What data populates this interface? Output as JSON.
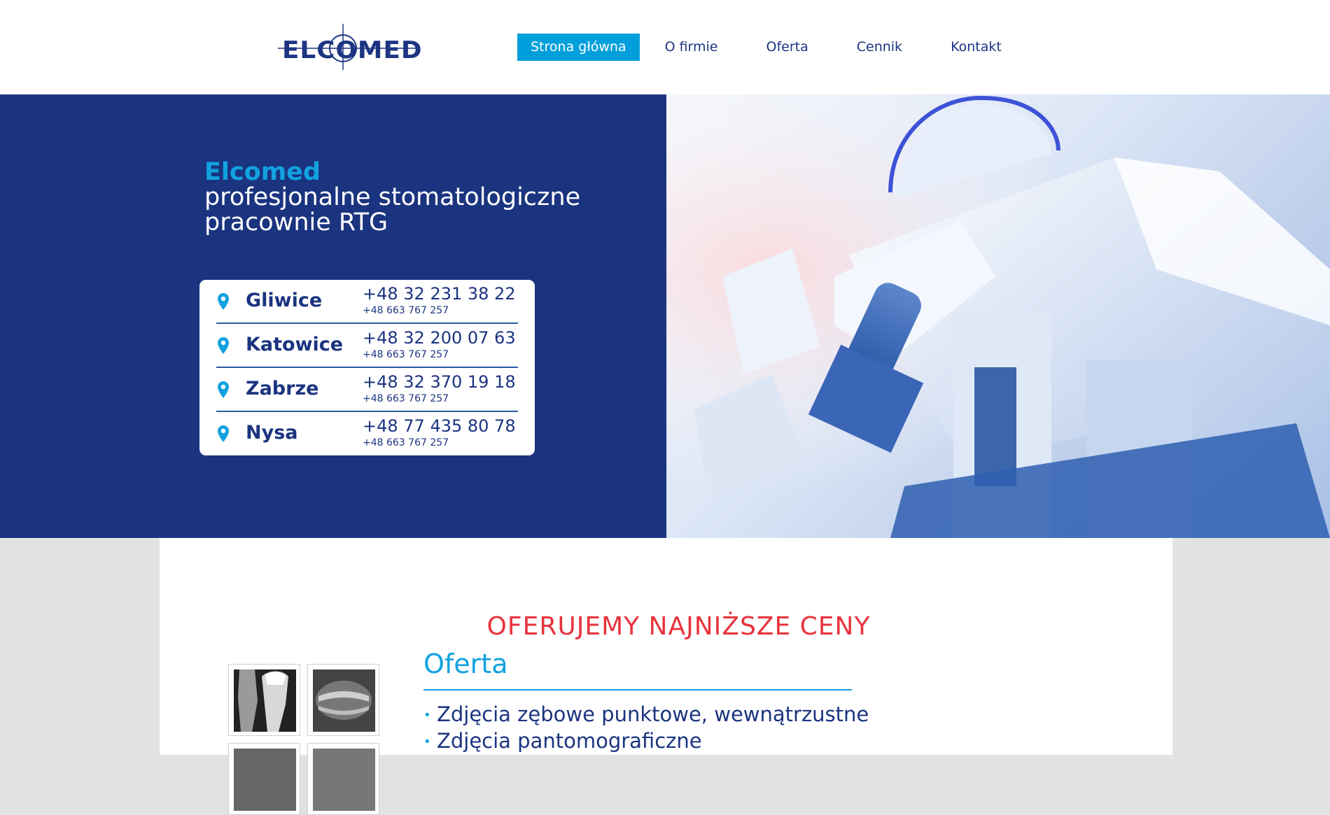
{
  "header": {
    "logo_text": "ELCOMED",
    "nav": [
      {
        "label": "Strona główna",
        "active": true
      },
      {
        "label": "O firmie",
        "active": false
      },
      {
        "label": "Oferta",
        "active": false
      },
      {
        "label": "Cennik",
        "active": false
      },
      {
        "label": "Kontakt",
        "active": false
      }
    ]
  },
  "hero": {
    "brand": "Elcomed",
    "line1": "profesjonalne stomatologiczne",
    "line2": "pracownie RTG",
    "image_icon": "x-ray-machine-photo",
    "locations": [
      {
        "city": "Gliwice",
        "phone": "+48 32 231 38 22",
        "mobile": "+48 663 767 257"
      },
      {
        "city": "Katowice",
        "phone": "+48 32 200 07 63",
        "mobile": "+48 663 767 257"
      },
      {
        "city": "Zabrze",
        "phone": "+48 32 370 19 18",
        "mobile": "+48 663 767 257"
      },
      {
        "city": "Nysa",
        "phone": "+48 77 435 80 78",
        "mobile": "+48 663 767 257"
      }
    ]
  },
  "content": {
    "headline": "OFERUJEMY NAJNIŻSZE CENY",
    "offer_title": "Oferta",
    "offer_items": [
      "Zdjęcia zębowe punktowe, wewnątrzustne",
      "Zdjęcia pantomograficzne"
    ]
  },
  "colors": {
    "navy": "#1b3480",
    "accent_blue": "#009fdb",
    "headline_red": "#e8333c",
    "page_gray": "#e2e2e2"
  }
}
